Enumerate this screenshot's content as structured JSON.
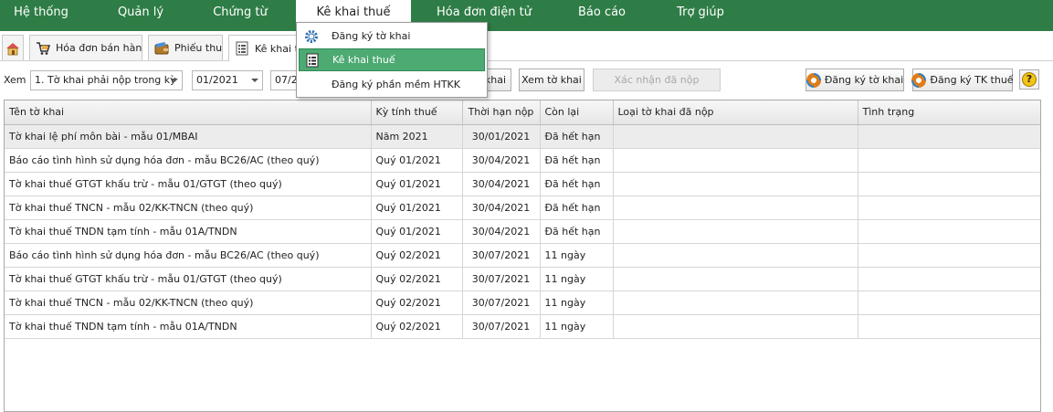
{
  "menubar": {
    "items": [
      {
        "label": "Hệ thống"
      },
      {
        "label": "Quản lý"
      },
      {
        "label": "Chứng từ"
      },
      {
        "label": "Kê khai thuế"
      },
      {
        "label": "Hóa đơn điện tử"
      },
      {
        "label": "Báo cáo"
      },
      {
        "label": "Trợ giúp"
      }
    ],
    "active_index": 3,
    "color": "#2e7d46"
  },
  "dropdown": {
    "items": [
      {
        "label": "Đăng ký tờ khai",
        "icon": "gear-icon"
      },
      {
        "label": "Kê khai thuế",
        "icon": "list-icon",
        "highlighted": true
      },
      {
        "label": "Đăng ký phần mềm HTKK",
        "icon": ""
      }
    ],
    "highlight_color": "#4caa72"
  },
  "tabs": {
    "home_icon": "home-icon",
    "items": [
      {
        "label": "Hóa đơn bán hàng",
        "icon": "cart-icon"
      },
      {
        "label": "Phiếu thu",
        "icon": "wallet-icon"
      },
      {
        "label": "Kê khai thu",
        "icon": "list-icon",
        "active": true
      }
    ]
  },
  "toolbar": {
    "view_label": "Xem",
    "filter_value": "1. Tờ khai phải nộp trong kỳ",
    "from_period": "01/2021",
    "to_period": "07/2",
    "partial_button_label": "khai",
    "view_return_label": "Xem tờ khai",
    "confirm_submitted_label": "Xác nhận đã nộp",
    "register_return_label": "Đăng ký tờ khai",
    "register_account_label": "Đăng ký TK thuế",
    "help_symbol": "?"
  },
  "grid": {
    "columns": [
      "Tên tờ khai",
      "Kỳ tính thuế",
      "Thời hạn nộp",
      "Còn lại",
      "Loại tờ khai đã nộp",
      "Tình trạng"
    ],
    "rows": [
      [
        "Tờ khai lệ phí môn bài - mẫu 01/MBAI",
        "Năm 2021",
        "30/01/2021",
        "Đã hết hạn",
        "",
        ""
      ],
      [
        "Báo cáo tình hình sử dụng hóa đơn - mẫu BC26/AC (theo quý)",
        "Quý 01/2021",
        "30/04/2021",
        "Đã hết hạn",
        "",
        ""
      ],
      [
        "Tờ khai thuế GTGT khấu trừ - mẫu 01/GTGT (theo quý)",
        "Quý 01/2021",
        "30/04/2021",
        "Đã hết hạn",
        "",
        ""
      ],
      [
        "Tờ khai thuế TNCN - mẫu 02/KK-TNCN (theo quý)",
        "Quý 01/2021",
        "30/04/2021",
        "Đã hết hạn",
        "",
        ""
      ],
      [
        "Tờ khai thuế TNDN tạm tính - mẫu 01A/TNDN",
        "Quý 01/2021",
        "30/04/2021",
        "Đã hết hạn",
        "",
        ""
      ],
      [
        "Báo cáo tình hình sử dụng hóa đơn - mẫu BC26/AC (theo quý)",
        "Quý 02/2021",
        "30/07/2021",
        "11 ngày",
        "",
        ""
      ],
      [
        "Tờ khai thuế GTGT khấu trừ - mẫu 01/GTGT (theo quý)",
        "Quý 02/2021",
        "30/07/2021",
        "11 ngày",
        "",
        ""
      ],
      [
        "Tờ khai thuế TNCN - mẫu 02/KK-TNCN (theo quý)",
        "Quý 02/2021",
        "30/07/2021",
        "11 ngày",
        "",
        ""
      ],
      [
        "Tờ khai thuế TNDN tạm tính - mẫu 01A/TNDN",
        "Quý 02/2021",
        "30/07/2021",
        "11 ngày",
        "",
        ""
      ]
    ],
    "selected_row": 0
  }
}
